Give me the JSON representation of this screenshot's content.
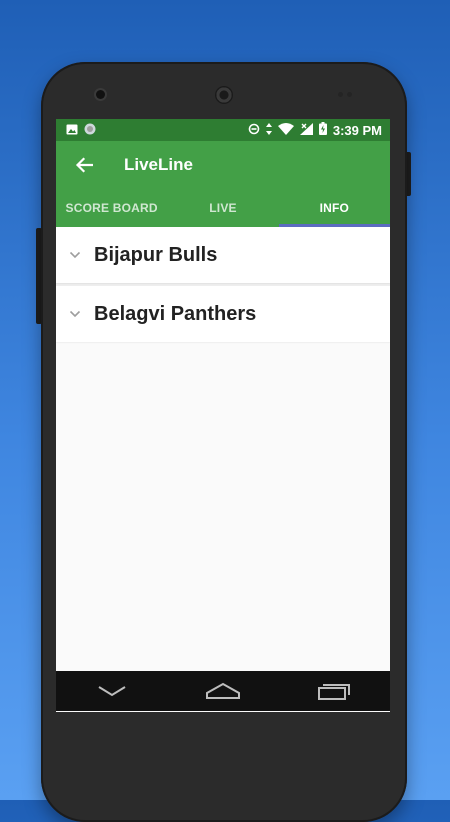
{
  "status_bar": {
    "time": "3:39 PM",
    "icons": [
      "image-icon",
      "circle-app-icon",
      "data-saver-icon",
      "data-transfer-icon",
      "wifi-icon",
      "signal-icon",
      "battery-charging-icon"
    ]
  },
  "app_bar": {
    "title": "LiveLine",
    "back_icon": "arrow-left-icon"
  },
  "tabs": [
    {
      "label": "SCORE BOARD",
      "active": false
    },
    {
      "label": "LIVE",
      "active": false
    },
    {
      "label": "INFO",
      "active": true
    }
  ],
  "teams": [
    {
      "name": "Bijapur Bulls",
      "icon": "chevron-down-icon"
    },
    {
      "name": "Belagvi Panthers",
      "icon": "chevron-down-icon"
    }
  ],
  "nav_bar": {
    "icons": [
      "back-nav-icon",
      "home-nav-icon",
      "recents-nav-icon"
    ]
  },
  "colors": {
    "status_bar": "#2e7d32",
    "app_bar": "#43a047",
    "tab_indicator": "#5c6bc0",
    "background_gradient_top": "#1f5fb6",
    "background_gradient_bottom": "#5aa0f2"
  }
}
